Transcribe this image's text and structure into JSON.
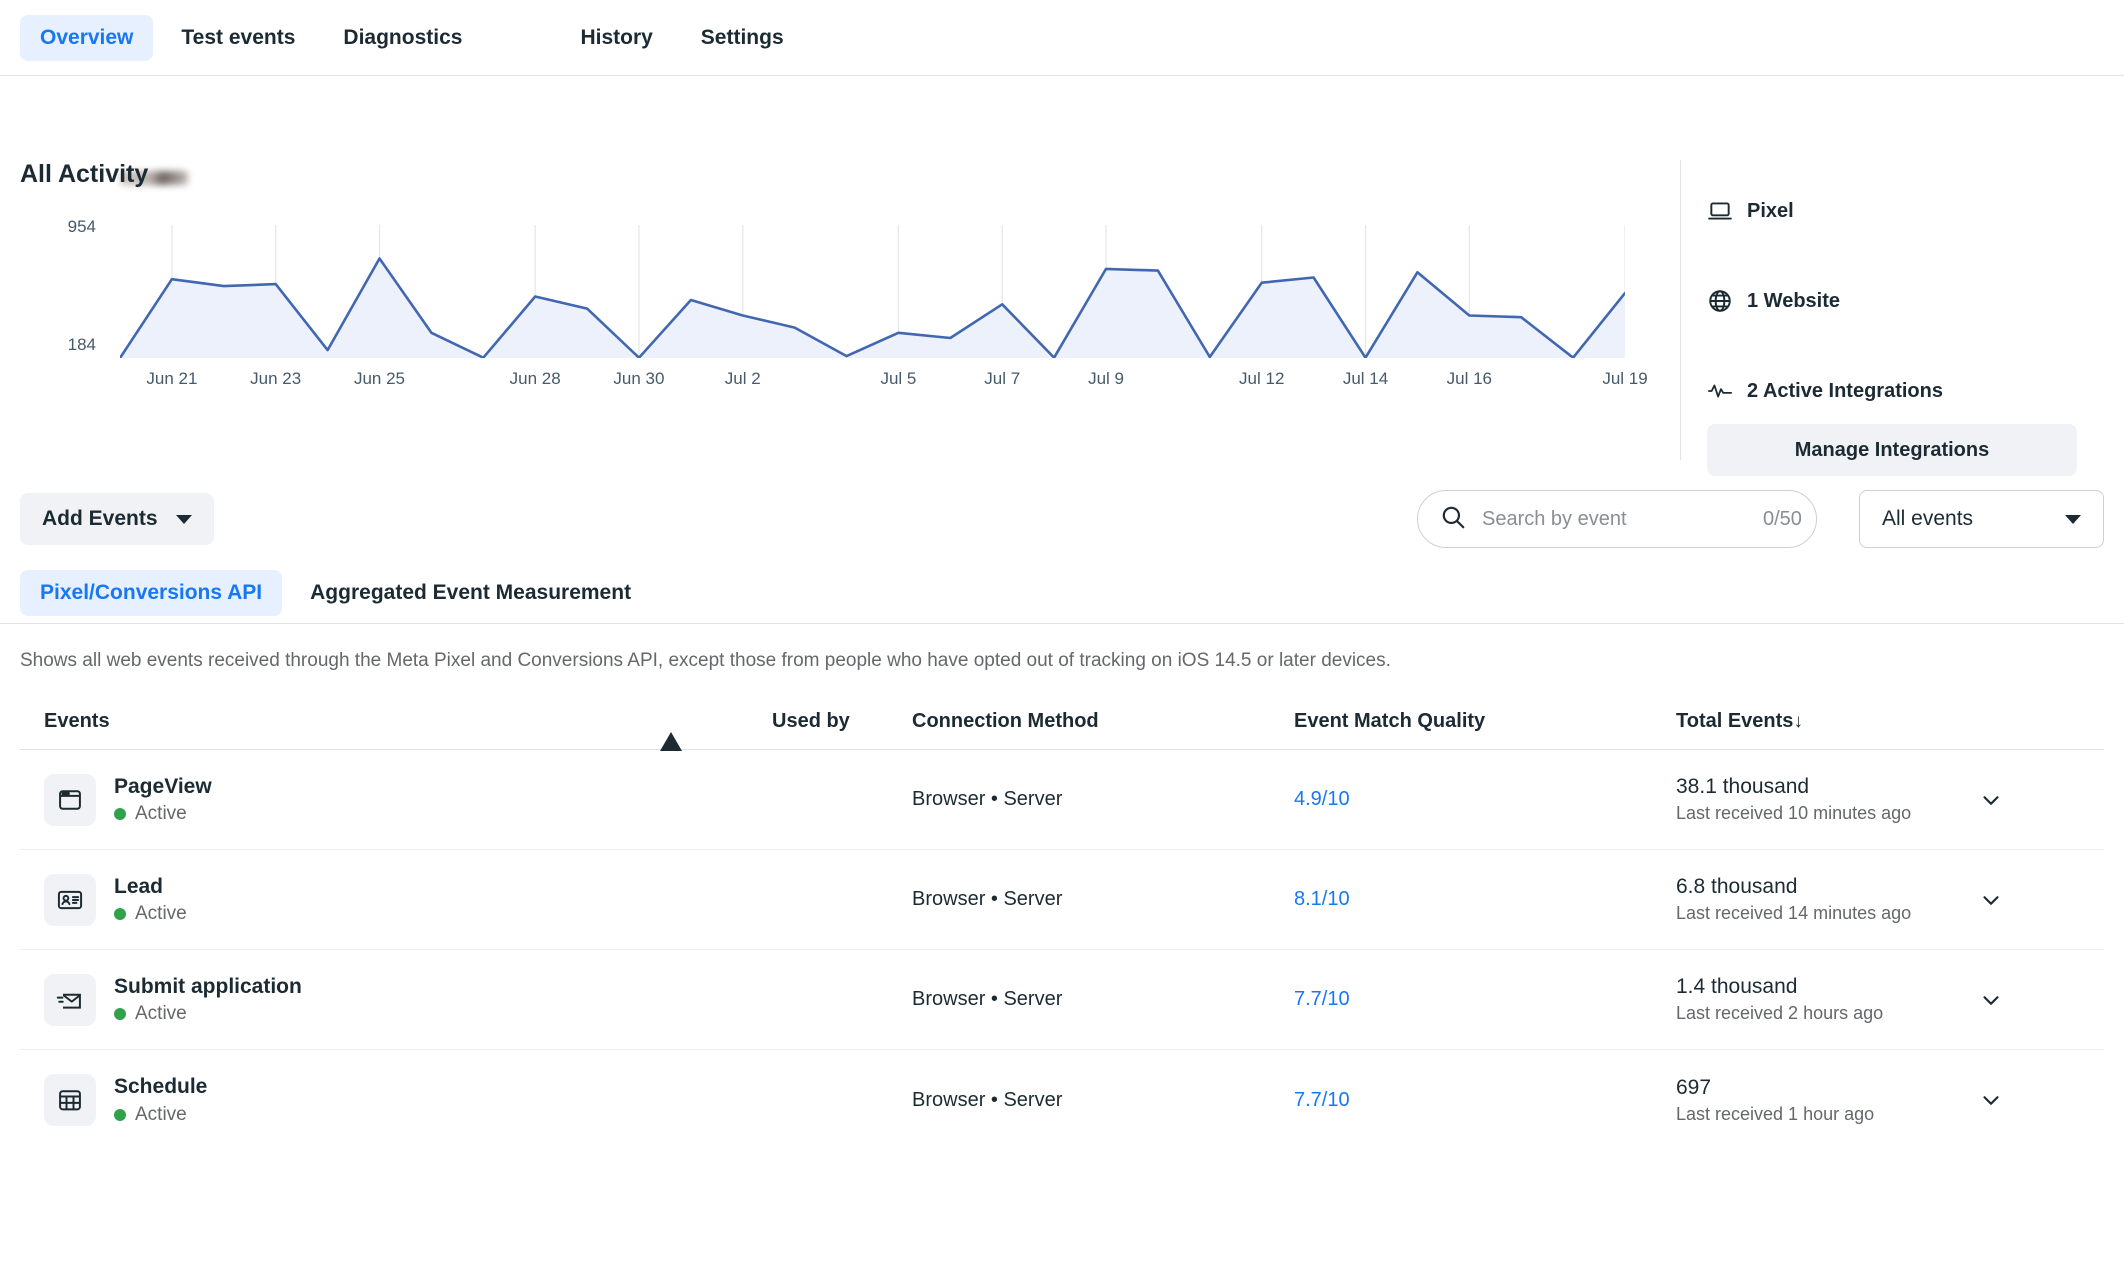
{
  "top_tabs": [
    {
      "label": "Overview",
      "active": true
    },
    {
      "label": "Test events",
      "active": false
    },
    {
      "label": "Diagnostics",
      "active": false
    },
    {
      "label": "History",
      "active": false
    },
    {
      "label": "Settings",
      "active": false
    }
  ],
  "activity": {
    "title": "All Activity",
    "y_top": "954",
    "y_bottom": "184"
  },
  "chart_data": {
    "type": "area",
    "title": "All Activity",
    "xlabel": "",
    "ylabel": "",
    "ylim": [
      184,
      954
    ],
    "grid": true,
    "legend": null,
    "tick_labels": [
      "Jun 21",
      "Jun 23",
      "Jun 25",
      "Jun 28",
      "Jun 30",
      "Jul 2",
      "Jul 5",
      "Jul 7",
      "Jul 9",
      "Jul 12",
      "Jul 14",
      "Jul 16",
      "Jul 19"
    ],
    "tick_positions": [
      1,
      3,
      5,
      8,
      10,
      12,
      15,
      17,
      19,
      22,
      24,
      26,
      29
    ],
    "x": [
      "Jun 20",
      "Jun 21",
      "Jun 22",
      "Jun 23",
      "Jun 24",
      "Jun 25",
      "Jun 26",
      "Jun 27",
      "Jun 28",
      "Jun 29",
      "Jun 30",
      "Jul 1",
      "Jul 2",
      "Jul 3",
      "Jul 4",
      "Jul 5",
      "Jul 6",
      "Jul 7",
      "Jul 8",
      "Jul 9",
      "Jul 10",
      "Jul 11",
      "Jul 12",
      "Jul 13",
      "Jul 14",
      "Jul 15",
      "Jul 16",
      "Jul 17",
      "Jul 18",
      "Jul 19"
    ],
    "values": [
      184,
      640,
      600,
      612,
      230,
      760,
      330,
      186,
      540,
      470,
      186,
      520,
      430,
      360,
      195,
      330,
      300,
      495,
      186,
      700,
      690,
      190,
      620,
      650,
      186,
      680,
      430,
      420,
      186,
      560
    ],
    "values_note": "Daily event volume, y-axis from 184 to 954",
    "series": [
      {
        "name": "All Activity",
        "values": [
          184,
          640,
          600,
          612,
          230,
          760,
          330,
          186,
          540,
          470,
          186,
          520,
          430,
          360,
          195,
          330,
          300,
          495,
          186,
          700,
          690,
          190,
          620,
          650,
          186,
          680,
          430,
          420,
          186,
          560
        ]
      }
    ],
    "color": "#4267b2",
    "fill_color": "#edf1fb"
  },
  "side_panel": {
    "rows": [
      {
        "icon": "laptop-icon",
        "label": "Pixel"
      },
      {
        "icon": "globe-icon",
        "label": "1 Website"
      },
      {
        "icon": "pulse-icon",
        "label": "2 Active Integrations"
      }
    ],
    "manage_button": "Manage Integrations"
  },
  "controls": {
    "add_events": "Add Events",
    "search_placeholder": "Search by event",
    "search_value": "",
    "search_count": "0/50",
    "filter_value": "All events"
  },
  "subtabs": [
    {
      "label": "Pixel/Conversions API",
      "active": true
    },
    {
      "label": "Aggregated Event Measurement",
      "active": false
    }
  ],
  "description": "Shows all web events received through the Meta Pixel and Conversions API, except those from people who have opted out of tracking on iOS 14.5 or later devices.",
  "table": {
    "headers": {
      "events": "Events",
      "warning": "warning-icon",
      "used_by": "Used by",
      "connection_method": "Connection Method",
      "event_match_quality": "Event Match Quality",
      "total_events": "Total Events",
      "sort_arrow": "↓"
    },
    "rows": [
      {
        "icon": "browser-window-icon",
        "name": "PageView",
        "status": "Active",
        "used_by": "",
        "connection": "Browser • Server",
        "emq": "4.9/10",
        "total": "38.1 thousand",
        "last_received": "Last received 10 minutes ago"
      },
      {
        "icon": "contact-card-icon",
        "name": "Lead",
        "status": "Active",
        "used_by": "",
        "connection": "Browser • Server",
        "emq": "8.1/10",
        "total": "6.8 thousand",
        "last_received": "Last received 14 minutes ago"
      },
      {
        "icon": "send-envelope-icon",
        "name": "Submit application",
        "status": "Active",
        "used_by": "",
        "connection": "Browser • Server",
        "emq": "7.7/10",
        "total": "1.4 thousand",
        "last_received": "Last received 2 hours ago"
      },
      {
        "icon": "calendar-grid-icon",
        "name": "Schedule",
        "status": "Active",
        "used_by": "",
        "connection": "Browser • Server",
        "emq": "7.7/10",
        "total": "697",
        "last_received": "Last received 1 hour ago"
      }
    ]
  },
  "colors": {
    "accent": "#1877f2",
    "accent_bg": "#e7f0fe",
    "chart_line": "#4267b2",
    "chart_fill": "#edf1fb",
    "status_green": "#31a24c",
    "text": "#1c2b33",
    "muted": "#65676b"
  }
}
